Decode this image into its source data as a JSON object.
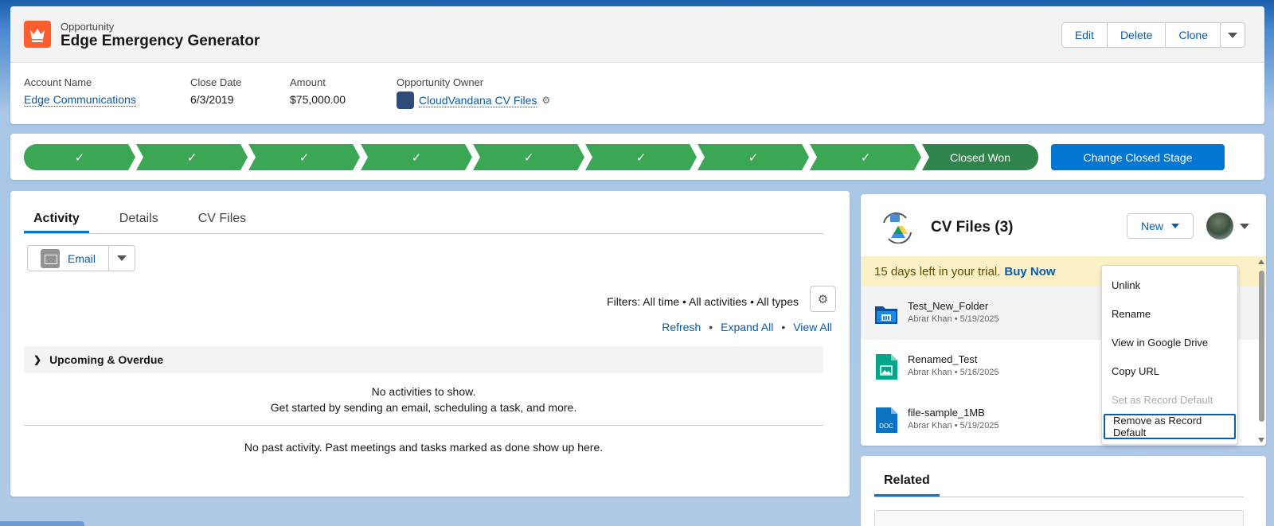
{
  "header": {
    "object_label": "Opportunity",
    "record_title": "Edge Emergency Generator",
    "buttons": [
      "Edit",
      "Delete",
      "Clone"
    ],
    "fields": [
      {
        "label": "Account Name",
        "value": "Edge Communications"
      },
      {
        "label": "Close Date",
        "value": "6/3/2019"
      },
      {
        "label": "Amount",
        "value": "$75,000.00"
      },
      {
        "label": "Opportunity Owner",
        "value": "CloudVandana CV Files"
      }
    ]
  },
  "path": {
    "steps": [
      "✓",
      "✓",
      "✓",
      "✓",
      "✓",
      "✓",
      "✓",
      "✓",
      "Closed Won"
    ],
    "action_label": "Change Closed Stage"
  },
  "activity": {
    "tabs": [
      "Activity",
      "Details",
      "CV Files"
    ],
    "email_label": "Email",
    "filters_text": "Filters: All time • All activities • All types",
    "links": [
      "Refresh",
      "Expand All",
      "View All"
    ],
    "upcoming_label": "Upcoming & Overdue",
    "no_activities": "No activities to show.",
    "get_started": "Get started by sending an email, scheduling a task, and more.",
    "no_past": "No past activity. Past meetings and tasks marked as done show up here."
  },
  "cv_files": {
    "title": "CV Files (3)",
    "new_label": "New",
    "trial_text": "15 days left in your trial.",
    "buy_now": "Buy Now",
    "files": [
      {
        "name": "Test_New_Folder",
        "meta": "Abrar Khan • 5/19/2025",
        "icon": "folder-icon"
      },
      {
        "name": "Renamed_Test",
        "meta": "Abrar Khan • 5/16/2025",
        "icon": "image-file-icon"
      },
      {
        "name": "file-sample_1MB",
        "meta": "Abrar Khan • 5/19/2025",
        "icon": "doc-file-icon"
      }
    ]
  },
  "context_menu": {
    "items": [
      "Unlink",
      "Rename",
      "View in Google Drive",
      "Copy URL",
      "Set as Record Default",
      "Remove as Record Default"
    ]
  },
  "related": {
    "tab_label": "Related"
  },
  "colors": {
    "path_complete": "#3ba755",
    "path_current": "#2e844a",
    "brand_blue": "#0176d3",
    "link_blue": "#0b5cab",
    "opportunity_icon": "#ff5d2d",
    "trial_banner": "#fcf0c6"
  }
}
